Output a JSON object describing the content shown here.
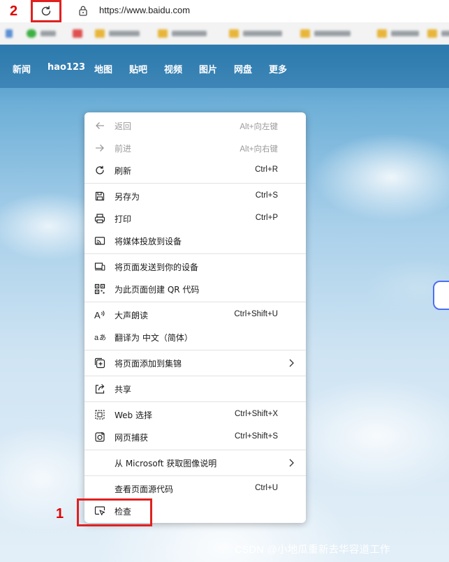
{
  "browser": {
    "url": "https://www.baidu.com",
    "annotation_reload": "2",
    "annotation_inspect": "1"
  },
  "nav": {
    "items": [
      "新闻",
      "hao123",
      "地图",
      "贴吧",
      "视频",
      "图片",
      "网盘",
      "更多"
    ]
  },
  "context_menu": {
    "items": [
      {
        "label": "返回",
        "shortcut": "Alt+向左键",
        "icon": "back-arrow-icon",
        "disabled": true
      },
      {
        "label": "前进",
        "shortcut": "Alt+向右键",
        "icon": "forward-arrow-icon",
        "disabled": true
      },
      {
        "label": "刷新",
        "shortcut": "Ctrl+R",
        "icon": "refresh-icon"
      },
      {
        "label": "另存为",
        "shortcut": "Ctrl+S",
        "icon": "save-icon"
      },
      {
        "label": "打印",
        "shortcut": "Ctrl+P",
        "icon": "print-icon"
      },
      {
        "label": "将媒体投放到设备",
        "shortcut": "",
        "icon": "cast-icon"
      },
      {
        "label": "将页面发送到你的设备",
        "shortcut": "",
        "icon": "send-to-device-icon"
      },
      {
        "label": "为此页面创建 QR 代码",
        "shortcut": "",
        "icon": "qr-code-icon"
      },
      {
        "label": "大声朗读",
        "shortcut": "Ctrl+Shift+U",
        "icon": "read-aloud-icon"
      },
      {
        "label": "翻译为 中文（简体）",
        "shortcut": "",
        "icon": "translate-icon"
      },
      {
        "label": "将页面添加到集锦",
        "shortcut": "",
        "icon": "collections-icon",
        "submenu": true
      },
      {
        "label": "共享",
        "shortcut": "",
        "icon": "share-icon"
      },
      {
        "label": "Web 选择",
        "shortcut": "Ctrl+Shift+X",
        "icon": "web-select-icon"
      },
      {
        "label": "网页捕获",
        "shortcut": "Ctrl+Shift+S",
        "icon": "web-capture-icon"
      },
      {
        "label": "从 Microsoft 获取图像说明",
        "shortcut": "",
        "icon": "",
        "submenu": true
      },
      {
        "label": "查看页面源代码",
        "shortcut": "Ctrl+U",
        "icon": ""
      },
      {
        "label": "检查",
        "shortcut": "",
        "icon": "inspect-icon"
      }
    ]
  },
  "watermark": "CSDN @小地瓜重新去华容道工作",
  "colors": {
    "annotation_red": "#e02020",
    "menu_bg": "#ffffff",
    "disabled_text": "#9a9a9a",
    "search_border": "#4e6ef2"
  }
}
